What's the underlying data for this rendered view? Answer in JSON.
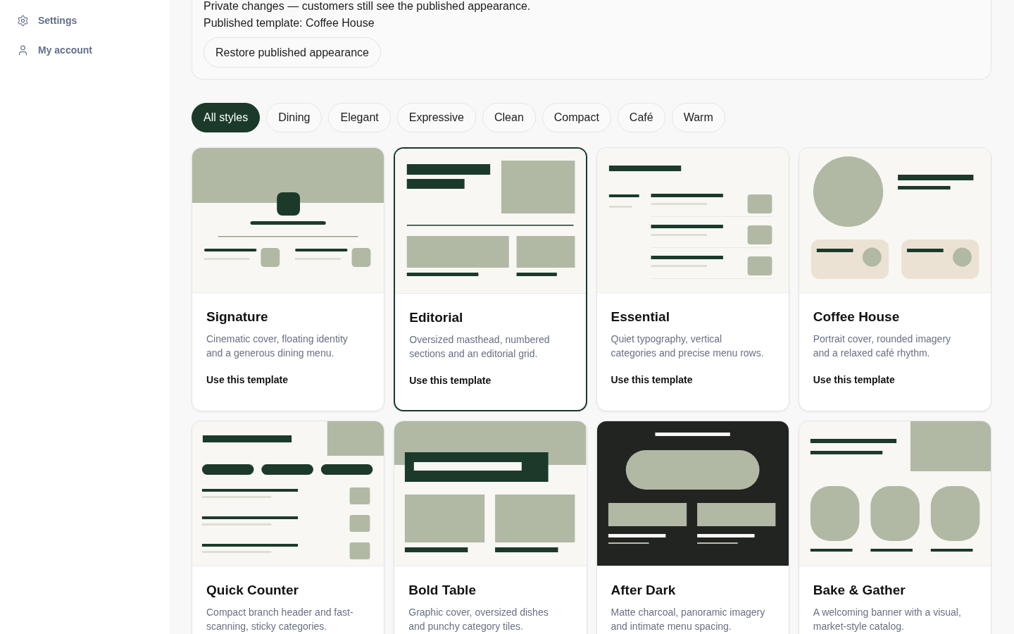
{
  "sidebar": {
    "items": [
      {
        "kind": "settings",
        "label": "Settings"
      },
      {
        "kind": "account",
        "label": "My account"
      }
    ]
  },
  "draft_notice": {
    "message": "Private changes — customers still see the published appearance.",
    "published": "Published template: Coffee House",
    "restore_button": "Restore published appearance"
  },
  "filters": [
    {
      "label": "All styles",
      "selected": true
    },
    {
      "label": "Dining",
      "selected": false
    },
    {
      "label": "Elegant",
      "selected": false
    },
    {
      "label": "Expressive",
      "selected": false
    },
    {
      "label": "Clean",
      "selected": false
    },
    {
      "label": "Compact",
      "selected": false
    },
    {
      "label": "Café",
      "selected": false
    },
    {
      "label": "Warm",
      "selected": false
    }
  ],
  "templates": [
    {
      "name": "Signature",
      "description": "Cinematic cover, floating identity and a generous dining menu.",
      "action": "Use this template",
      "selected": false,
      "kind": "signature"
    },
    {
      "name": "Editorial",
      "description": "Oversized masthead, numbered sections and an editorial grid.",
      "action": "Use this template",
      "selected": true,
      "kind": "editorial"
    },
    {
      "name": "Essential",
      "description": "Quiet typography, vertical categories and precise menu rows.",
      "action": "Use this template",
      "selected": false,
      "kind": "essential"
    },
    {
      "name": "Coffee House",
      "description": "Portrait cover, rounded imagery and a relaxed café rhythm.",
      "action": "Use this template",
      "selected": false,
      "kind": "coffee"
    },
    {
      "name": "Quick Counter",
      "description": "Compact branch header and fast-scanning, sticky categories.",
      "selected": false,
      "kind": "counter"
    },
    {
      "name": "Bold Table",
      "description": "Graphic cover, oversized dishes and punchy category tiles.",
      "selected": false,
      "kind": "bold"
    },
    {
      "name": "After Dark",
      "description": "Matte charcoal, panoramic imagery and intimate menu spacing.",
      "selected": false,
      "kind": "dark"
    },
    {
      "name": "Bake & Gather",
      "description": "A welcoming banner with a visual, market-style catalog.",
      "selected": false,
      "kind": "bake"
    }
  ]
}
